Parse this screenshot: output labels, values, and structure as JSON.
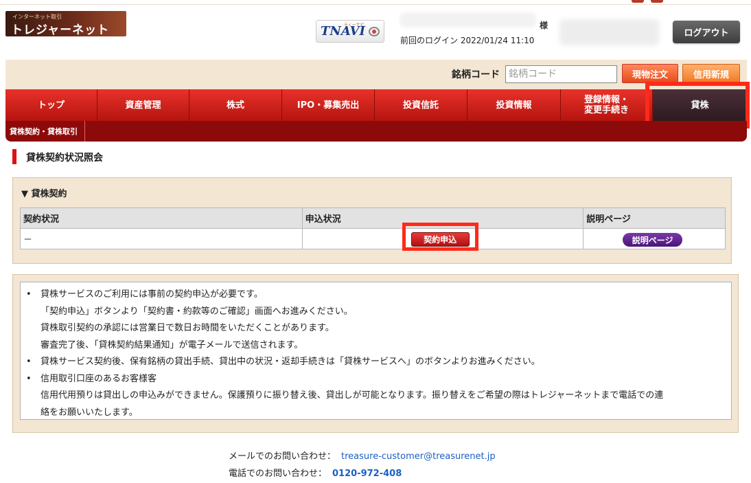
{
  "header": {
    "logo_small": "インターネット取引",
    "logo_main": "トレジャーネット",
    "tnavi_sub": "ティーナビ",
    "tnavi_text": "TNAVI",
    "honorific": "様",
    "last_login_label": "前回のログイン",
    "last_login_value": "2022/01/24 11:10",
    "logout_label": "ログアウト"
  },
  "search": {
    "label": "銘柄コード",
    "placeholder": "銘柄コード",
    "spot_order_label": "現物注文",
    "margin_new_label": "信用新規"
  },
  "nav": {
    "items": [
      {
        "label": "トップ"
      },
      {
        "label": "資産管理"
      },
      {
        "label": "株式"
      },
      {
        "label": "IPO・募集売出"
      },
      {
        "label": "投資信託"
      },
      {
        "label": "投資情報"
      },
      {
        "label": "登録情報・\n変更手続き"
      },
      {
        "label": "貸株"
      }
    ],
    "active_index": 7,
    "sub_items": [
      {
        "label": "貸株契約・貸株取引"
      }
    ]
  },
  "page": {
    "title": "貸株契約状況照会"
  },
  "contract": {
    "heading": "▼ 貸株契約",
    "columns": [
      "契約状況",
      "申込状況",
      "説明ページ"
    ],
    "row": {
      "status": "－",
      "apply_button": "契約申込",
      "explain_button": "説明ページ"
    }
  },
  "notes": {
    "lines": [
      {
        "bullet": "•",
        "text": "貸株サービスのご利用には事前の契約申込が必要です。"
      },
      {
        "bullet": "",
        "text": "「契約申込」ボタンより「契約書・約款等のご確認」画面へお進みください。"
      },
      {
        "bullet": "",
        "text": "貸株取引契約の承認には営業日で数日お時間をいただくことがあります。"
      },
      {
        "bullet": "",
        "text": "審査完了後、「貸株契約結果通知」が電子メールで送信されます。"
      },
      {
        "bullet": "•",
        "text": "貸株サービス契約後、保有銘柄の貸出手続、貸出中の状況・返却手続きは「貸株サービスへ」のボタンよりお進みください。"
      },
      {
        "bullet": "•",
        "text": "信用取引口座のあるお客様客"
      },
      {
        "bullet": "",
        "text": "信用代用預りは貸出しの申込みができません。保護預りに振り替え後、貸出しが可能となります。振り替えをご希望の際はトレジャーネットまで電話での連"
      },
      {
        "bullet": "",
        "text": "絡をお願いいたします。"
      }
    ]
  },
  "footer": {
    "mail_label": "メールでのお問い合わせ：",
    "mail_value": "treasure-customer@treasurenet.jp",
    "tel_label": "電話でのお問い合わせ：",
    "tel_value": "0120-972-408"
  },
  "colors": {
    "nav_red": "#c81e16",
    "nav_active": "#3a2228",
    "highlight": "#ff2a1a",
    "panel_beige": "#f3e6d3",
    "link_blue": "#1a5fc4"
  }
}
